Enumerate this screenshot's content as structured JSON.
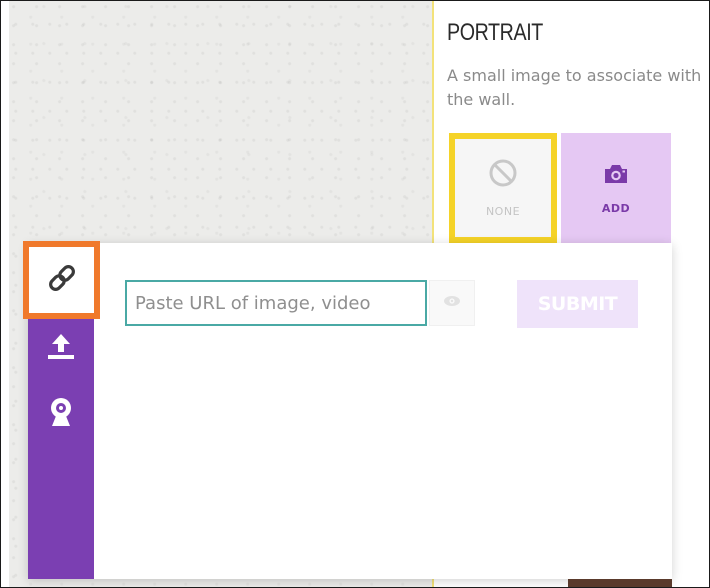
{
  "portrait": {
    "title": "PORTRAIT",
    "description": "A small image to associate with the wall.",
    "options": [
      {
        "label": "NONE",
        "icon": "ban-icon",
        "selected": true
      },
      {
        "label": "ADD",
        "icon": "camera-icon",
        "selected": false
      }
    ]
  },
  "uploader": {
    "tabs": [
      {
        "icon": "link-icon",
        "active": true
      },
      {
        "icon": "upload-icon",
        "active": false
      },
      {
        "icon": "webcam-icon",
        "active": false
      }
    ],
    "url_input": {
      "placeholder": "Paste URL of image, video",
      "value": ""
    },
    "preview_icon": "eye-icon",
    "submit_label": "SUBMIT"
  },
  "colors": {
    "accent_purple": "#7b3fb2",
    "selected_border": "#f5d328",
    "highlight_orange": "#f0792b",
    "input_border": "#4aa9a5",
    "submit_disabled": "#efe3fa"
  }
}
